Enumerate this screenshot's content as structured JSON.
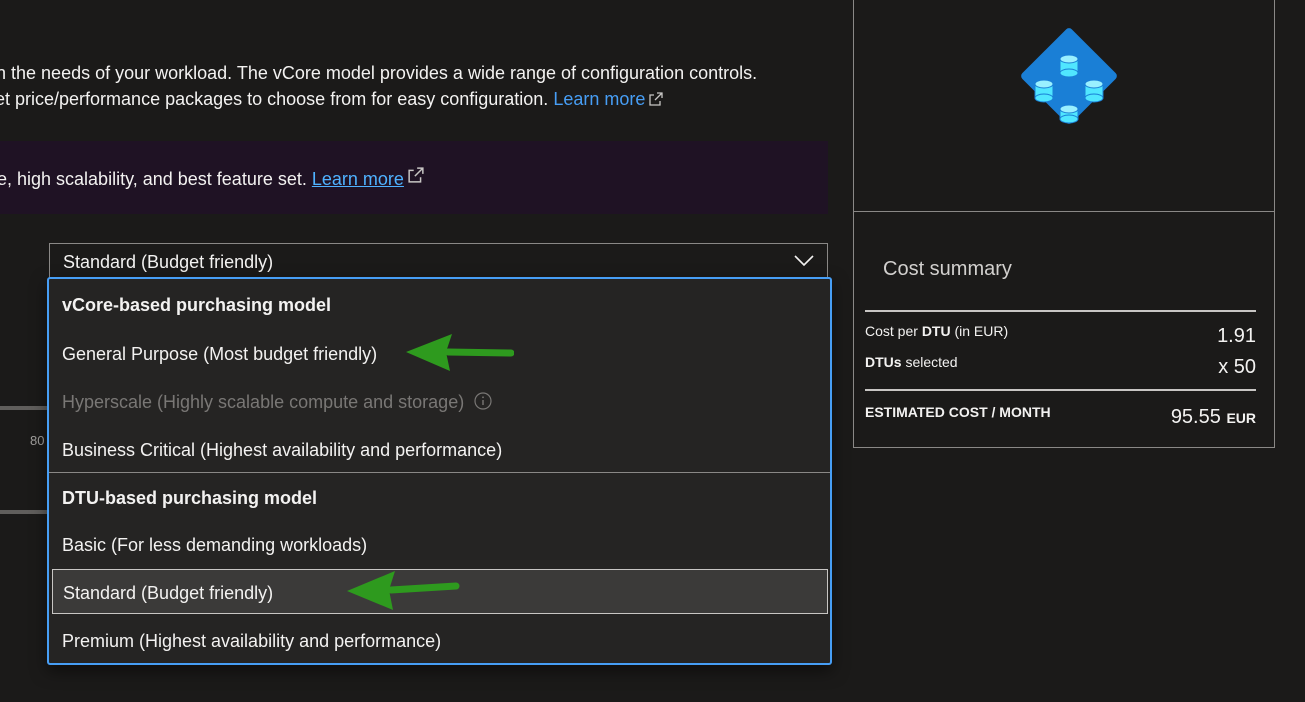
{
  "description": {
    "line1": "on the needs of your workload. The vCore model provides a wide range of configuration controls.",
    "line2": "set price/performance packages to choose from for easy configuration.",
    "learn_more": "Learn more"
  },
  "banner": {
    "text": "rice, high scalability, and best feature set.",
    "learn_more": "Learn more"
  },
  "service_tier": {
    "selected_value": "Standard (Budget friendly)"
  },
  "dropdown": {
    "vcore_header": "vCore-based purchasing model",
    "vcore_options": [
      "General Purpose (Most budget friendly)",
      "Hyperscale (Highly scalable compute and storage)",
      "Business Critical (Highest availability and performance)"
    ],
    "dtu_header": "DTU-based purchasing model",
    "dtu_options": [
      "Basic (For less demanding workloads)",
      "Standard (Budget friendly)",
      "Premium (Highest availability and performance)"
    ]
  },
  "side_fragment": "80",
  "cost_summary": {
    "title": "Cost summary",
    "cost_per_dtu_prefix": "Cost per ",
    "cost_per_dtu_bold": "DTU",
    "cost_per_dtu_suffix": " (in EUR)",
    "cost_per_dtu_value": "1.91",
    "dtus_bold": "DTUs",
    "dtus_suffix": " selected",
    "dtus_value": "x 50",
    "estimated_label": "ESTIMATED COST / MONTH",
    "estimated_value": "95.55",
    "estimated_unit": "EUR"
  },
  "colors": {
    "accent": "#479ef5",
    "annotation_arrow": "#2e9a1e",
    "banner_bg": "#1f1224"
  }
}
